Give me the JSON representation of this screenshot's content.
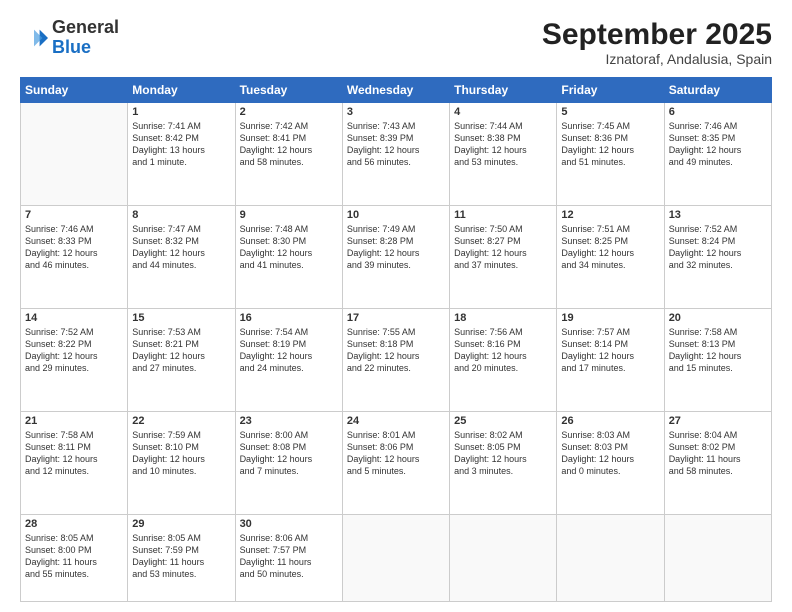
{
  "logo": {
    "general": "General",
    "blue": "Blue"
  },
  "header": {
    "month": "September 2025",
    "location": "Iznatoraf, Andalusia, Spain"
  },
  "days_of_week": [
    "Sunday",
    "Monday",
    "Tuesday",
    "Wednesday",
    "Thursday",
    "Friday",
    "Saturday"
  ],
  "weeks": [
    [
      {
        "day": "",
        "info": ""
      },
      {
        "day": "1",
        "info": "Sunrise: 7:41 AM\nSunset: 8:42 PM\nDaylight: 13 hours\nand 1 minute."
      },
      {
        "day": "2",
        "info": "Sunrise: 7:42 AM\nSunset: 8:41 PM\nDaylight: 12 hours\nand 58 minutes."
      },
      {
        "day": "3",
        "info": "Sunrise: 7:43 AM\nSunset: 8:39 PM\nDaylight: 12 hours\nand 56 minutes."
      },
      {
        "day": "4",
        "info": "Sunrise: 7:44 AM\nSunset: 8:38 PM\nDaylight: 12 hours\nand 53 minutes."
      },
      {
        "day": "5",
        "info": "Sunrise: 7:45 AM\nSunset: 8:36 PM\nDaylight: 12 hours\nand 51 minutes."
      },
      {
        "day": "6",
        "info": "Sunrise: 7:46 AM\nSunset: 8:35 PM\nDaylight: 12 hours\nand 49 minutes."
      }
    ],
    [
      {
        "day": "7",
        "info": "Sunrise: 7:46 AM\nSunset: 8:33 PM\nDaylight: 12 hours\nand 46 minutes."
      },
      {
        "day": "8",
        "info": "Sunrise: 7:47 AM\nSunset: 8:32 PM\nDaylight: 12 hours\nand 44 minutes."
      },
      {
        "day": "9",
        "info": "Sunrise: 7:48 AM\nSunset: 8:30 PM\nDaylight: 12 hours\nand 41 minutes."
      },
      {
        "day": "10",
        "info": "Sunrise: 7:49 AM\nSunset: 8:28 PM\nDaylight: 12 hours\nand 39 minutes."
      },
      {
        "day": "11",
        "info": "Sunrise: 7:50 AM\nSunset: 8:27 PM\nDaylight: 12 hours\nand 37 minutes."
      },
      {
        "day": "12",
        "info": "Sunrise: 7:51 AM\nSunset: 8:25 PM\nDaylight: 12 hours\nand 34 minutes."
      },
      {
        "day": "13",
        "info": "Sunrise: 7:52 AM\nSunset: 8:24 PM\nDaylight: 12 hours\nand 32 minutes."
      }
    ],
    [
      {
        "day": "14",
        "info": "Sunrise: 7:52 AM\nSunset: 8:22 PM\nDaylight: 12 hours\nand 29 minutes."
      },
      {
        "day": "15",
        "info": "Sunrise: 7:53 AM\nSunset: 8:21 PM\nDaylight: 12 hours\nand 27 minutes."
      },
      {
        "day": "16",
        "info": "Sunrise: 7:54 AM\nSunset: 8:19 PM\nDaylight: 12 hours\nand 24 minutes."
      },
      {
        "day": "17",
        "info": "Sunrise: 7:55 AM\nSunset: 8:18 PM\nDaylight: 12 hours\nand 22 minutes."
      },
      {
        "day": "18",
        "info": "Sunrise: 7:56 AM\nSunset: 8:16 PM\nDaylight: 12 hours\nand 20 minutes."
      },
      {
        "day": "19",
        "info": "Sunrise: 7:57 AM\nSunset: 8:14 PM\nDaylight: 12 hours\nand 17 minutes."
      },
      {
        "day": "20",
        "info": "Sunrise: 7:58 AM\nSunset: 8:13 PM\nDaylight: 12 hours\nand 15 minutes."
      }
    ],
    [
      {
        "day": "21",
        "info": "Sunrise: 7:58 AM\nSunset: 8:11 PM\nDaylight: 12 hours\nand 12 minutes."
      },
      {
        "day": "22",
        "info": "Sunrise: 7:59 AM\nSunset: 8:10 PM\nDaylight: 12 hours\nand 10 minutes."
      },
      {
        "day": "23",
        "info": "Sunrise: 8:00 AM\nSunset: 8:08 PM\nDaylight: 12 hours\nand 7 minutes."
      },
      {
        "day": "24",
        "info": "Sunrise: 8:01 AM\nSunset: 8:06 PM\nDaylight: 12 hours\nand 5 minutes."
      },
      {
        "day": "25",
        "info": "Sunrise: 8:02 AM\nSunset: 8:05 PM\nDaylight: 12 hours\nand 3 minutes."
      },
      {
        "day": "26",
        "info": "Sunrise: 8:03 AM\nSunset: 8:03 PM\nDaylight: 12 hours\nand 0 minutes."
      },
      {
        "day": "27",
        "info": "Sunrise: 8:04 AM\nSunset: 8:02 PM\nDaylight: 11 hours\nand 58 minutes."
      }
    ],
    [
      {
        "day": "28",
        "info": "Sunrise: 8:05 AM\nSunset: 8:00 PM\nDaylight: 11 hours\nand 55 minutes."
      },
      {
        "day": "29",
        "info": "Sunrise: 8:05 AM\nSunset: 7:59 PM\nDaylight: 11 hours\nand 53 minutes."
      },
      {
        "day": "30",
        "info": "Sunrise: 8:06 AM\nSunset: 7:57 PM\nDaylight: 11 hours\nand 50 minutes."
      },
      {
        "day": "",
        "info": ""
      },
      {
        "day": "",
        "info": ""
      },
      {
        "day": "",
        "info": ""
      },
      {
        "day": "",
        "info": ""
      }
    ]
  ]
}
